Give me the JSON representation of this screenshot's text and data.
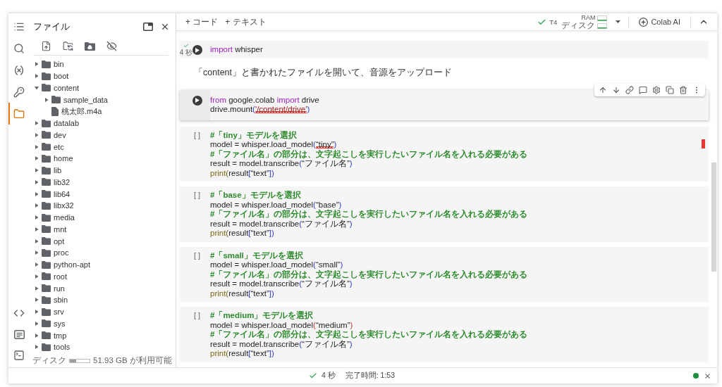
{
  "toolbar": {
    "add_buttons": [
      "+ コード",
      "+ テキスト"
    ],
    "runtime": {
      "connected": true,
      "name": "T4",
      "ram_label": "RAM",
      "disk_label": "ディスク"
    },
    "ai_button": "Colab AI"
  },
  "rail": {
    "top": [
      {
        "kind": "toc",
        "selected": false
      },
      {
        "kind": "search",
        "selected": false
      },
      {
        "kind": "variables",
        "selected": false
      },
      {
        "kind": "secrets",
        "selected": false
      },
      {
        "kind": "files",
        "selected": true
      }
    ],
    "bottom": [
      {
        "kind": "snippets",
        "selected": false
      },
      {
        "kind": "palette",
        "selected": false
      },
      {
        "kind": "terminal",
        "selected": false
      }
    ]
  },
  "files": {
    "title": "ファイル",
    "tree": [
      {
        "name": "bin",
        "kind": "folder",
        "expanded": false
      },
      {
        "name": "boot",
        "kind": "folder",
        "expanded": false
      },
      {
        "name": "content",
        "kind": "folder",
        "expanded": true,
        "children": [
          {
            "name": "sample_data",
            "kind": "folder",
            "expanded": false
          },
          {
            "name": "桃太郎.m4a",
            "kind": "file"
          }
        ]
      },
      {
        "name": "datalab",
        "kind": "folder",
        "expanded": false
      },
      {
        "name": "dev",
        "kind": "folder",
        "expanded": false
      },
      {
        "name": "etc",
        "kind": "folder",
        "expanded": false
      },
      {
        "name": "home",
        "kind": "folder",
        "expanded": false
      },
      {
        "name": "lib",
        "kind": "folder",
        "expanded": false
      },
      {
        "name": "lib32",
        "kind": "folder",
        "expanded": false
      },
      {
        "name": "lib64",
        "kind": "folder",
        "expanded": false
      },
      {
        "name": "libx32",
        "kind": "folder",
        "expanded": false
      },
      {
        "name": "media",
        "kind": "folder",
        "expanded": false
      },
      {
        "name": "mnt",
        "kind": "folder",
        "expanded": false
      },
      {
        "name": "opt",
        "kind": "folder",
        "expanded": false
      },
      {
        "name": "proc",
        "kind": "folder",
        "expanded": false
      },
      {
        "name": "python-apt",
        "kind": "folder",
        "expanded": false
      },
      {
        "name": "root",
        "kind": "folder",
        "expanded": false
      },
      {
        "name": "run",
        "kind": "folder",
        "expanded": false
      },
      {
        "name": "sbin",
        "kind": "folder",
        "expanded": false
      },
      {
        "name": "srv",
        "kind": "folder",
        "expanded": false
      },
      {
        "name": "sys",
        "kind": "folder",
        "expanded": false
      },
      {
        "name": "tmp",
        "kind": "folder",
        "expanded": false
      },
      {
        "name": "tools",
        "kind": "folder",
        "expanded": false
      }
    ],
    "disk": {
      "label": "ディスク",
      "level": 0.33,
      "reading": "51.93 GB が利用可能"
    }
  },
  "cells": [
    {
      "kind": "code",
      "focused": false,
      "flagged": false,
      "exec": {
        "done": true,
        "time": "4 秒"
      },
      "lines": [
        [
          {
            "text": "import",
            "kind": "keyword",
            "squiggle": false
          },
          {
            "text": " whisper",
            "kind": "plain",
            "squiggle": false
          }
        ]
      ]
    },
    {
      "kind": "text",
      "text": "「content」と書かれたファイルを開いて、音源をアップロード"
    },
    {
      "kind": "code",
      "focused": true,
      "flagged": false,
      "lines": [
        [
          {
            "text": "from",
            "kind": "keyword",
            "squiggle": false
          },
          {
            "text": " google.colab ",
            "kind": "plain",
            "squiggle": false
          },
          {
            "text": "import",
            "kind": "keyword",
            "squiggle": false
          },
          {
            "text": " drive",
            "kind": "plain",
            "squiggle": false
          }
        ],
        [
          {
            "text": "drive.mount",
            "kind": "plain",
            "squiggle": false
          },
          {
            "text": "(",
            "kind": "bracket",
            "squiggle": false
          },
          {
            "text": "'/content/drive'",
            "kind": "string",
            "squiggle": true
          },
          {
            "text": ")",
            "kind": "bracket",
            "squiggle": false
          }
        ]
      ]
    },
    {
      "kind": "code",
      "focused": false,
      "flagged": true,
      "prompt": "[ ]",
      "lines": [
        [
          {
            "text": "#「tiny」モデルを選択",
            "kind": "comment",
            "squiggle": false
          }
        ],
        [
          {
            "text": "model = whisper.load_model",
            "kind": "plain",
            "squiggle": false
          },
          {
            "text": "(",
            "kind": "bracket",
            "squiggle": false
          },
          {
            "text": "“tiny”",
            "kind": "plain",
            "squiggle": true
          },
          {
            "text": ")",
            "kind": "bracket",
            "squiggle": false
          }
        ],
        [
          {
            "text": "#「ファイル名」の部分は、文字起こしを実行したいファイル名を入れる必要がある",
            "kind": "comment",
            "squiggle": false
          }
        ],
        [
          {
            "text": "result = model.transcribe",
            "kind": "plain",
            "squiggle": false
          },
          {
            "text": "(",
            "kind": "bracket",
            "squiggle": false
          },
          {
            "text": "“ファイル名”",
            "kind": "plain",
            "squiggle": false
          },
          {
            "text": ")",
            "kind": "bracket",
            "squiggle": false
          }
        ],
        [
          {
            "text": "print(",
            "kind": "func",
            "squiggle": false
          },
          {
            "text": "result",
            "kind": "plain",
            "squiggle": false
          },
          {
            "text": "[",
            "kind": "bracket",
            "squiggle": false
          },
          {
            "text": "“text”",
            "kind": "plain",
            "squiggle": false
          },
          {
            "text": "]",
            "kind": "bracket",
            "squiggle": false
          },
          {
            "text": ")",
            "kind": "bracket",
            "squiggle": false
          }
        ]
      ]
    },
    {
      "kind": "code",
      "focused": false,
      "flagged": false,
      "prompt": "[ ]",
      "lines": [
        [
          {
            "text": "#「base」モデルを選択",
            "kind": "comment",
            "squiggle": false
          }
        ],
        [
          {
            "text": "model = whisper.load_model",
            "kind": "plain",
            "squiggle": false
          },
          {
            "text": "(",
            "kind": "bracket",
            "squiggle": false
          },
          {
            "text": "“base”",
            "kind": "plain",
            "squiggle": false
          },
          {
            "text": ")",
            "kind": "bracket",
            "squiggle": false
          }
        ],
        [
          {
            "text": "#「ファイル名」の部分は、文字起こしを実行したいファイル名を入れる必要がある",
            "kind": "comment",
            "squiggle": false
          }
        ],
        [
          {
            "text": "result = model.transcribe",
            "kind": "plain",
            "squiggle": false
          },
          {
            "text": "(",
            "kind": "bracket",
            "squiggle": false
          },
          {
            "text": "“ファイル名”",
            "kind": "plain",
            "squiggle": false
          },
          {
            "text": ")",
            "kind": "bracket",
            "squiggle": false
          }
        ],
        [
          {
            "text": "print(",
            "kind": "func",
            "squiggle": false
          },
          {
            "text": "result",
            "kind": "plain",
            "squiggle": false
          },
          {
            "text": "[",
            "kind": "bracket",
            "squiggle": false
          },
          {
            "text": "“text”",
            "kind": "plain",
            "squiggle": false
          },
          {
            "text": "]",
            "kind": "bracket",
            "squiggle": false
          },
          {
            "text": ")",
            "kind": "bracket",
            "squiggle": false
          }
        ]
      ]
    },
    {
      "kind": "code",
      "focused": false,
      "flagged": false,
      "prompt": "[ ]",
      "lines": [
        [
          {
            "text": "#「small」モデルを選択",
            "kind": "comment",
            "squiggle": false
          }
        ],
        [
          {
            "text": "model = whisper.load_model",
            "kind": "plain",
            "squiggle": false
          },
          {
            "text": "(",
            "kind": "bracket",
            "squiggle": false
          },
          {
            "text": "“small”",
            "kind": "plain",
            "squiggle": false
          },
          {
            "text": ")",
            "kind": "bracket",
            "squiggle": false
          }
        ],
        [
          {
            "text": "#「ファイル名」の部分は、文字起こしを実行したいファイル名を入れる必要がある",
            "kind": "comment",
            "squiggle": false
          }
        ],
        [
          {
            "text": "result = model.transcribe",
            "kind": "plain",
            "squiggle": false
          },
          {
            "text": "(",
            "kind": "bracket",
            "squiggle": false
          },
          {
            "text": "“ファイル名”",
            "kind": "plain",
            "squiggle": false
          },
          {
            "text": ")",
            "kind": "bracket",
            "squiggle": false
          }
        ],
        [
          {
            "text": "print(",
            "kind": "func",
            "squiggle": false
          },
          {
            "text": "result",
            "kind": "plain",
            "squiggle": false
          },
          {
            "text": "[",
            "kind": "bracket",
            "squiggle": false
          },
          {
            "text": "“text”",
            "kind": "plain",
            "squiggle": false
          },
          {
            "text": "]",
            "kind": "bracket",
            "squiggle": false
          },
          {
            "text": ")",
            "kind": "bracket",
            "squiggle": false
          }
        ]
      ]
    },
    {
      "kind": "code",
      "focused": false,
      "flagged": false,
      "prompt": "[ ]",
      "lines": [
        [
          {
            "text": "#「medium」モデルを選択",
            "kind": "comment",
            "squiggle": false
          }
        ],
        [
          {
            "text": "model = whisper.load_model",
            "kind": "plain",
            "squiggle": false
          },
          {
            "text": "(",
            "kind": "bracket_alt",
            "squiggle": false
          },
          {
            "text": "“medium”",
            "kind": "plain",
            "squiggle": false
          },
          {
            "text": ")",
            "kind": "bracket_alt",
            "squiggle": false
          }
        ],
        [
          {
            "text": "#「ファイル名」の部分は、文字起こしを実行したいファイル名を入れる必要がある",
            "kind": "comment",
            "squiggle": false
          }
        ],
        [
          {
            "text": "result = model.transcribe",
            "kind": "plain",
            "squiggle": false
          },
          {
            "text": "(",
            "kind": "bracket",
            "squiggle": false
          },
          {
            "text": "“ファイル名”",
            "kind": "plain",
            "squiggle": false
          },
          {
            "text": ")",
            "kind": "bracket",
            "squiggle": false
          }
        ],
        [
          {
            "text": "print(",
            "kind": "func",
            "squiggle": false
          },
          {
            "text": "result",
            "kind": "plain",
            "squiggle": false
          },
          {
            "text": "[",
            "kind": "bracket",
            "squiggle": false
          },
          {
            "text": "“text”",
            "kind": "plain",
            "squiggle": false
          },
          {
            "text": "]",
            "kind": "bracket",
            "squiggle": false
          },
          {
            "text": ")",
            "kind": "bracket",
            "squiggle": false
          }
        ]
      ]
    }
  ],
  "status_bar": {
    "done": true,
    "duration": "4 秒",
    "finish": "完了時間: 1:53",
    "connected": true
  }
}
